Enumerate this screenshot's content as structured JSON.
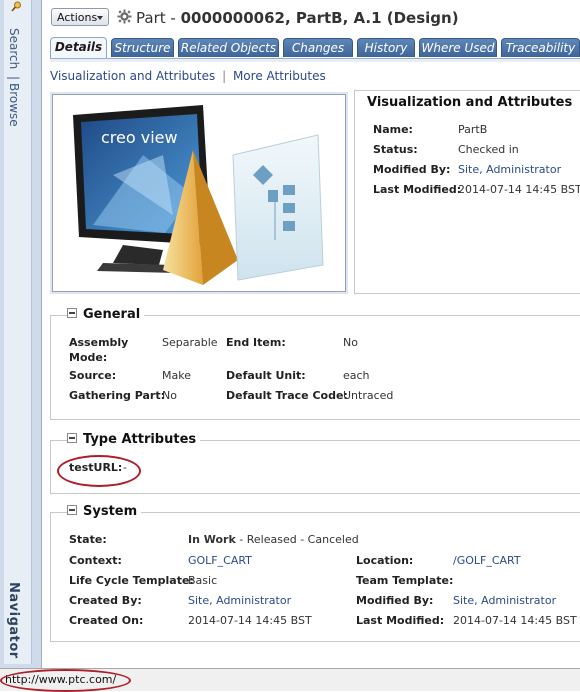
{
  "navigator": {
    "search_label": "Search",
    "separator": "|",
    "browse_label": "Browse",
    "navigator_label": "Navigator"
  },
  "header": {
    "actions_label": "Actions",
    "title_prefix": "Part -",
    "title_main": "0000000062, PartB, A.1 (Design)"
  },
  "tabs": [
    {
      "label": "Details",
      "active": true
    },
    {
      "label": "Structure"
    },
    {
      "label": "Related Objects"
    },
    {
      "label": "Changes"
    },
    {
      "label": "History"
    },
    {
      "label": "Where Used"
    },
    {
      "label": "Traceability"
    }
  ],
  "sublinks": {
    "viz_link": "Visualization and Attributes",
    "separator": "|",
    "more_link": "More Attributes"
  },
  "viz": {
    "brand_text": "creo view"
  },
  "viz_attributes": {
    "title": "Visualization and Attributes",
    "rows": [
      {
        "label": "Name:",
        "value": "PartB",
        "is_link": false
      },
      {
        "label": "Status:",
        "value": "Checked in",
        "is_link": false
      },
      {
        "label": "Modified By:",
        "value": "Site, Administrator",
        "is_link": true
      },
      {
        "label": "Last Modified:",
        "value": "2014-07-14 14:45 BST",
        "is_link": false
      }
    ]
  },
  "general": {
    "title": "General",
    "assembly_mode_label_1": "Assembly",
    "assembly_mode_label_2": "Mode:",
    "assembly_mode_value": "Separable",
    "end_item_label": "End Item:",
    "end_item_value": "No",
    "source_label": "Source:",
    "source_value": "Make",
    "default_unit_label": "Default Unit:",
    "default_unit_value": "each",
    "gathering_part_label": "Gathering Part:",
    "gathering_part_value": "No",
    "default_trace_code_label": "Default Trace Code:",
    "default_trace_code_value": "Untraced"
  },
  "type_attributes": {
    "title": "Type Attributes",
    "testurl_label": "testURL:",
    "testurl_value": "-"
  },
  "system": {
    "title": "System",
    "state_label": "State:",
    "state_current": "In Work",
    "state_rest": "- Released - Canceled",
    "context_label": "Context:",
    "context_value": "GOLF_CART",
    "location_label": "Location:",
    "location_value": "/GOLF_CART",
    "lifecycle_label": "Life Cycle Template:",
    "lifecycle_value": "Basic",
    "team_template_label": "Team Template:",
    "created_by_label": "Created By:",
    "created_by_value": "Site, Administrator",
    "modified_by_label": "Modified By:",
    "modified_by_value": "Site, Administrator",
    "created_on_label": "Created On:",
    "created_on_value": "2014-07-14 14:45 BST",
    "last_modified_label": "Last Modified:",
    "last_modified_value": "2014-07-14 14:45 BST"
  },
  "statusbar": {
    "url": "http://www.ptc.com/"
  },
  "colors": {
    "tab_blue": "#3e6599",
    "link_blue": "#2a4a8a",
    "highlight_red": "#b01e2a"
  }
}
